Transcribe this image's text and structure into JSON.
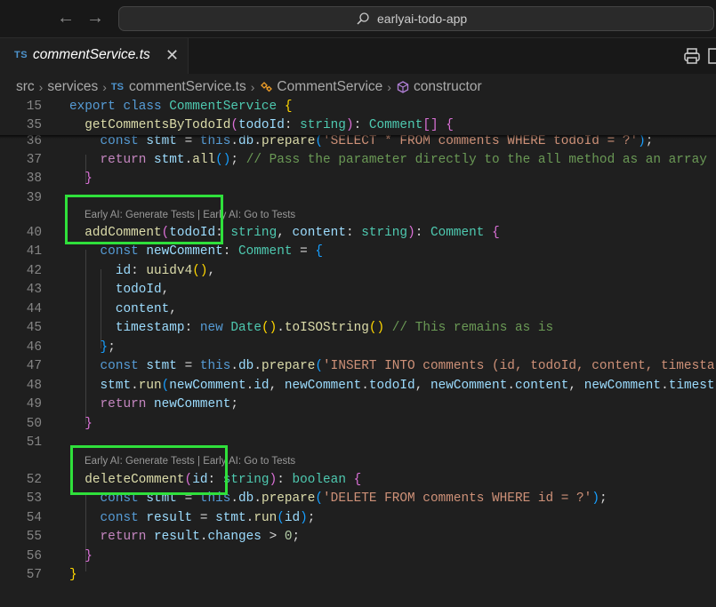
{
  "titlebar": {
    "search_text": "earlyai-todo-app"
  },
  "tab": {
    "type_badge": "TS",
    "filename": "commentService.ts",
    "close": "✕"
  },
  "breadcrumb": {
    "items": [
      "src",
      "services",
      "commentService.ts",
      "CommentService",
      "constructor"
    ],
    "ts_badge": "TS"
  },
  "editor": {
    "line_numbers": {
      "l15": "15",
      "l35": "35",
      "l36": "36",
      "l37": "37",
      "l38": "38",
      "l39": "39",
      "l40": "40",
      "l41": "41",
      "l42": "42",
      "l43": "43",
      "l44": "44",
      "l45": "45",
      "l46": "46",
      "l47": "47",
      "l48": "48",
      "l49": "49",
      "l50": "50",
      "l51": "51",
      "l52": "52",
      "l53": "53",
      "l54": "54",
      "l55": "55",
      "l56": "56",
      "l57": "57"
    },
    "codelens": {
      "generate_tests": "Early AI: Generate Tests",
      "separator": "|",
      "go_to_tests": "Early AI: Go to Tests"
    },
    "tokens": {
      "export": "export",
      "class": "class",
      "CommentService": "CommentService",
      "lbrace": "{",
      "getCommentsByTodoId": "getCommentsByTodoId",
      "lparen": "(",
      "rparen": ")",
      "todoId": "todoId",
      "colon": ":",
      "string": "string",
      "Comment": "Comment",
      "arr": "[]",
      "const": "const",
      "stmt": "stmt",
      "eq": "=",
      "this": "this",
      "dot": ".",
      "db": "db",
      "prepare": "prepare",
      "sql_select": "'SELECT * FROM comments WHERE todoId = ?'",
      "semi": ";",
      "return": "return",
      "all": "all",
      "comment_all": "// Pass the parameter directly to the all method as an array",
      "rbrace": "}",
      "addComment": "addComment",
      "comma": ",",
      "content": "content",
      "newComment": "newComment",
      "id": "id",
      "uuidv4": "uuidv4",
      "timestamp": "timestamp",
      "new": "new",
      "Date": "Date",
      "toISOString": "toISOString",
      "comment_remains": "// This remains as is",
      "sql_insert": "'INSERT INTO comments (id, todoId, content, timesta",
      "run": "run",
      "timest": "timest",
      "deleteComment": "deleteComment",
      "boolean": "boolean",
      "sql_delete": "'DELETE FROM comments WHERE id = ?'",
      "result": "result",
      "changes": "changes",
      "gt": ">",
      "zero": "0"
    }
  },
  "highlight_color": "#2fe03b"
}
